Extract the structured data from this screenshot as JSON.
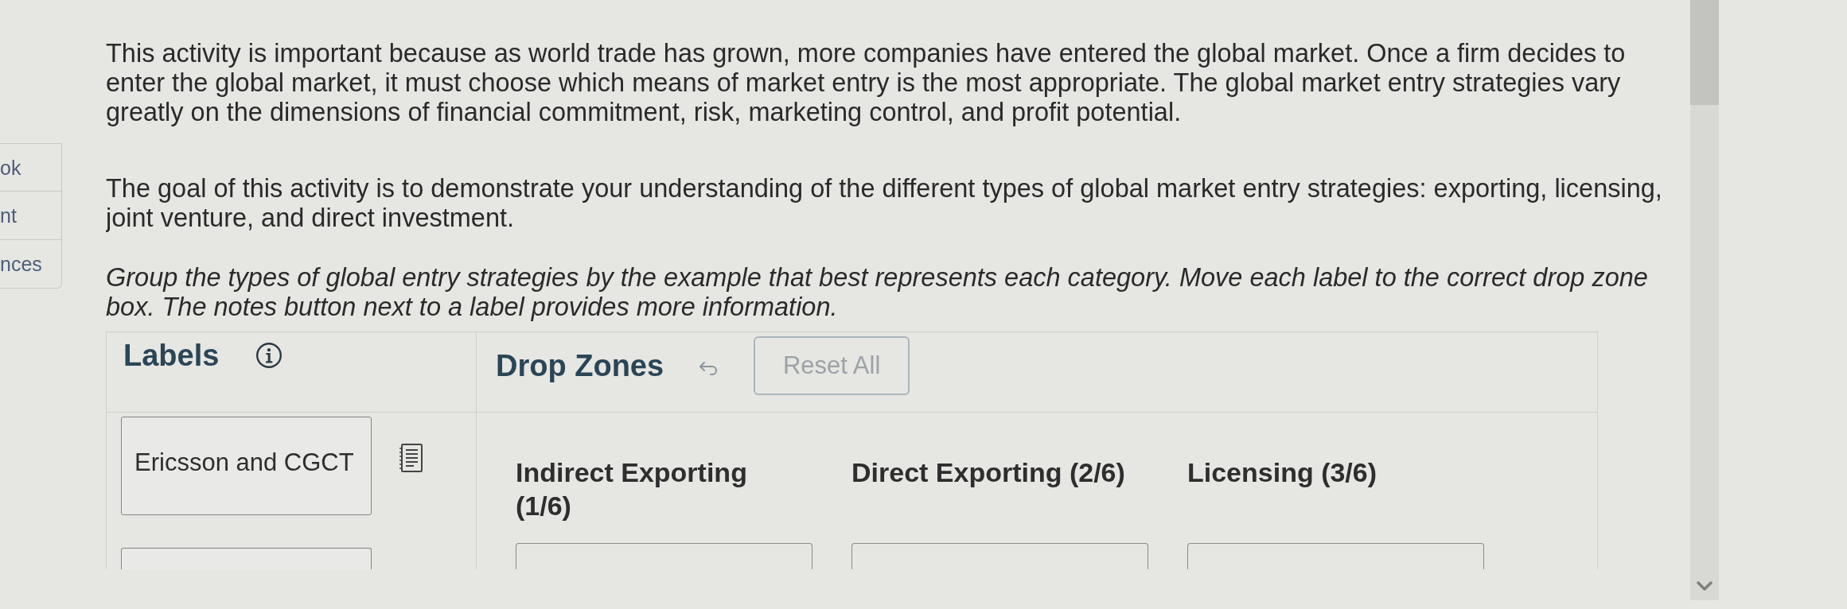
{
  "side_tabs": [
    {
      "label": "ok"
    },
    {
      "label": "nt"
    },
    {
      "label": "nces"
    }
  ],
  "instructions": [
    {
      "kind": "plain",
      "text": "This activity is important because as world trade has grown, more companies have entered the global market. Once a firm decides to enter the global market, it must choose which means of market entry is the most appropriate. The global market entry strategies vary greatly on the dimensions of financial commitment, risk, marketing control, and profit potential."
    },
    {
      "kind": "plain",
      "text": "The goal of this activity is to demonstrate your understanding of the different types of global market entry strategies: exporting, licensing, joint venture, and direct investment."
    },
    {
      "kind": "italic",
      "text": "Group the types of global entry strategies by the example that best represents each category. Move each label to the correct drop zone box. The notes button next to a label provides more information."
    }
  ],
  "labels_panel": {
    "title": "Labels",
    "labels": [
      {
        "text": "Ericsson and CGCT",
        "notes": true
      },
      {
        "notes": false
      }
    ]
  },
  "drop_zones_panel": {
    "title": "Drop Zones",
    "reset_button": {
      "label": "Reset All",
      "disabled": true
    },
    "zones": [
      {
        "title": "Indirect Exporting (1/6)"
      },
      {
        "title": "Direct Exporting (2/6)"
      },
      {
        "title": "Licensing (3/6)"
      }
    ]
  }
}
